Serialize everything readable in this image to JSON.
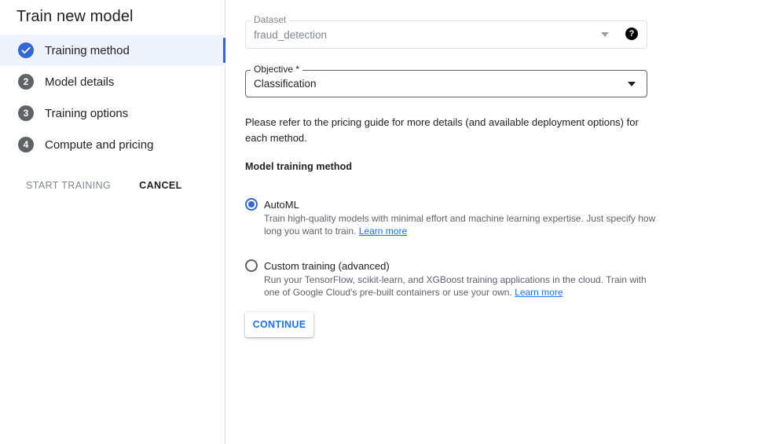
{
  "sidebar": {
    "title": "Train new model",
    "steps": [
      {
        "marker": "",
        "label": "Training method",
        "state": "completed",
        "icon": "check-icon"
      },
      {
        "marker": "2",
        "label": "Model details",
        "state": "pending"
      },
      {
        "marker": "3",
        "label": "Training options",
        "state": "pending"
      },
      {
        "marker": "4",
        "label": "Compute and pricing",
        "state": "pending"
      }
    ],
    "start_training_label": "START TRAINING",
    "cancel_label": "CANCEL"
  },
  "form": {
    "dataset": {
      "label": "Dataset",
      "value": "fraud_detection",
      "help_icon": "help-circle-icon",
      "help_glyph": "?"
    },
    "objective": {
      "label": "Objective *",
      "value": "Classification"
    },
    "note": "Please refer to the pricing guide for more details (and available deployment options) for each method.",
    "method_heading": "Model training method",
    "methods": [
      {
        "title": "AutoML",
        "description": "Train high-quality models with minimal effort and machine learning expertise. Just specify how long you want to train.",
        "link": "Learn more",
        "selected": true
      },
      {
        "title": "Custom training (advanced)",
        "description": "Run your TensorFlow, scikit-learn, and XGBoost training applications in the cloud. Train with one of Google Cloud's pre-built containers or use your own.",
        "link": "Learn more",
        "selected": false
      }
    ],
    "continue_label": "CONTINUE"
  },
  "colors": {
    "accent": "#3367d6",
    "link": "#1a73e8",
    "active_step_bg": "#eef3fd",
    "step_marker": "#5f6368"
  }
}
